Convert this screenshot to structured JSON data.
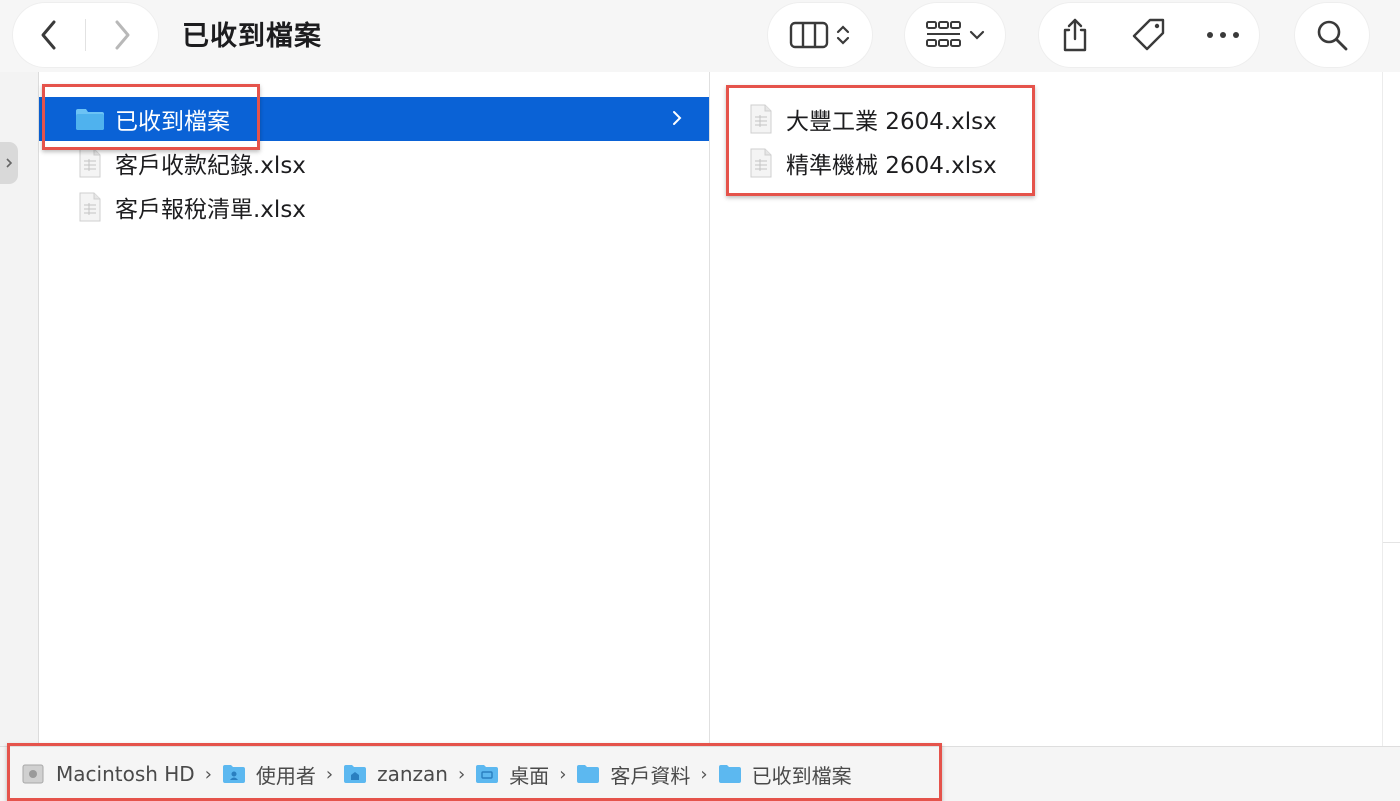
{
  "window": {
    "title": "已收到檔案"
  },
  "toolbar": {
    "back_icon": "chevron-left-icon",
    "forward_icon": "chevron-right-icon",
    "view_icon": "column-view-icon",
    "group_icon": "group-grid-icon",
    "share_icon": "share-icon",
    "tag_icon": "tag-icon",
    "more_icon": "more-icon",
    "search_icon": "search-icon"
  },
  "column1": {
    "items": [
      {
        "label": "已收到檔案",
        "type": "folder",
        "selected": true
      },
      {
        "label": "客戶收款紀錄.xlsx",
        "type": "file"
      },
      {
        "label": "客戶報稅清單.xlsx",
        "type": "file"
      }
    ]
  },
  "column2": {
    "items": [
      {
        "label": "大豐工業 2604.xlsx",
        "type": "file"
      },
      {
        "label": "精準機械 2604.xlsx",
        "type": "file"
      }
    ]
  },
  "pathbar": {
    "items": [
      {
        "label": "Macintosh HD",
        "icon": "disk-icon"
      },
      {
        "label": "使用者",
        "icon": "users-folder-icon"
      },
      {
        "label": "zanzan",
        "icon": "home-folder-icon"
      },
      {
        "label": "桌面",
        "icon": "desktop-folder-icon"
      },
      {
        "label": "客戶資料",
        "icon": "folder-icon"
      },
      {
        "label": "已收到檔案",
        "icon": "folder-icon"
      }
    ]
  },
  "colors": {
    "selection": "#0a62d6",
    "highlight_box": "#e5534b",
    "folder": "#5cb8f0"
  }
}
